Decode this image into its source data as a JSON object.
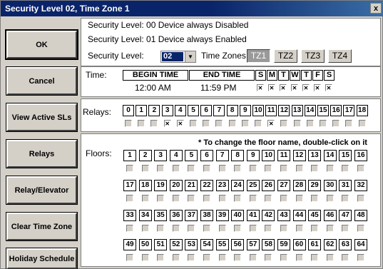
{
  "window": {
    "title": "Security Level 02, Time Zone 1",
    "close_label": "x"
  },
  "buttons": [
    {
      "label": "OK"
    },
    {
      "label": "Cancel"
    },
    {
      "label": "View Active SLs"
    },
    {
      "label": "Relays"
    },
    {
      "label": "Relay/Elevator"
    },
    {
      "label": "Clear Time Zone"
    },
    {
      "label": "Holiday Schedule"
    }
  ],
  "security": {
    "line1": "Security Level:  00 Device always Disabled",
    "line2": "Security Level:  01 Device always Enabled",
    "select_label": "Security Level:",
    "selected_value": "02",
    "time_zones_label": "Time Zones:",
    "time_zones": [
      "TZ1",
      "TZ2",
      "TZ3",
      "TZ4"
    ],
    "active_time_zone": "TZ1"
  },
  "time": {
    "label": "Time:",
    "begin_header": "BEGIN TIME",
    "end_header": "END TIME",
    "begin_value": "12:00 AM",
    "end_value": "11:59 PM",
    "days": [
      "S",
      "M",
      "T",
      "W",
      "T",
      "F",
      "S"
    ],
    "day_checked": [
      true,
      true,
      true,
      true,
      true,
      true,
      true
    ]
  },
  "relays": {
    "label": "Relays:",
    "numbers": [
      "0",
      "1",
      "2",
      "3",
      "4",
      "5",
      "6",
      "7",
      "8",
      "9",
      "10",
      "11",
      "12",
      "13",
      "14",
      "15",
      "16",
      "17",
      "18"
    ],
    "checked": [
      false,
      false,
      false,
      true,
      true,
      false,
      false,
      false,
      false,
      false,
      false,
      true,
      false,
      false,
      false,
      false,
      false,
      false,
      false
    ]
  },
  "floors": {
    "label": "Floors:",
    "note": "* To change the floor name, double-click on it",
    "rows": [
      [
        "1",
        "2",
        "3",
        "4",
        "5",
        "6",
        "7",
        "8",
        "9",
        "10",
        "11",
        "12",
        "13",
        "14",
        "15",
        "16"
      ],
      [
        "17",
        "18",
        "19",
        "20",
        "21",
        "22",
        "23",
        "24",
        "25",
        "26",
        "27",
        "28",
        "29",
        "30",
        "31",
        "32"
      ],
      [
        "33",
        "34",
        "35",
        "36",
        "37",
        "38",
        "39",
        "40",
        "41",
        "42",
        "43",
        "44",
        "45",
        "46",
        "47",
        "48"
      ],
      [
        "49",
        "50",
        "51",
        "52",
        "53",
        "54",
        "55",
        "56",
        "57",
        "58",
        "59",
        "60",
        "61",
        "62",
        "63",
        "64"
      ]
    ]
  }
}
